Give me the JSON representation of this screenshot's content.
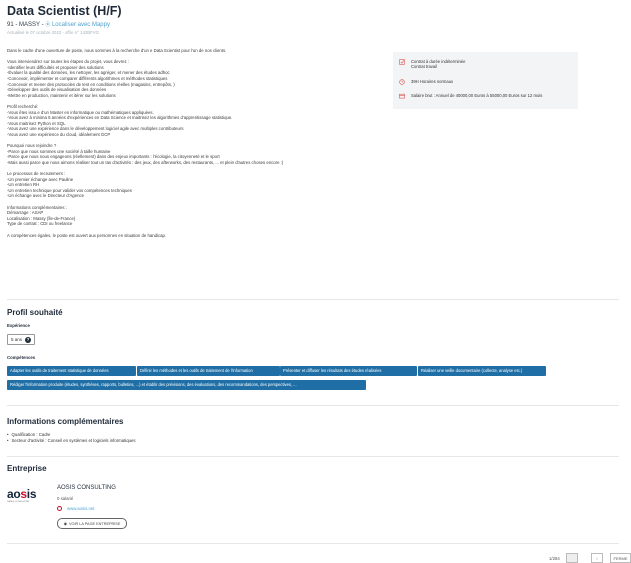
{
  "job": {
    "title": "Data Scientist (H/F)",
    "location": "91 - MASSY -",
    "locate_link": "Localiser avec Mappy",
    "updated": "Actualisé le 07 octobre 2022 - offre n° 142BFVG"
  },
  "description": [
    [
      "Dans le cadre d'une ouverture de poste, nous sommes à la recherche d'un e Data Scientist pour l'un de nos clients."
    ],
    [
      "Vous interviendrez sur toutes les étapes du projet, vous devrez :",
      "-Identifier leurs difficultés et proposer des solutions",
      "-Évaluer la qualité des données, les nettoyer, les agréger, et mener des études adhoc",
      "-Concevoir, implémenter et comparer différents algorithmes et méthodes statistiques",
      "-Concevoir et mener des protocoles de test en conditions réelles (magasins, entrepôts, )",
      "-Développer des outils de visualisation des données",
      "-Mettre en production, maintenir et itérer sur les solutions"
    ],
    [
      "Profil recherché:",
      "-Vous êtes issu.e d'un Master en informatique ou mathématiques appliquées.",
      "-Vous avez à minima 5 années d'expériences en Data Science et maitrisez les algorithmes d'apprentissage statistique.",
      "-Vous maitrisez Python et SQL",
      "-Vous avez une expérience dans le développement logiciel agile avec multiples contributeurs",
      "-Vous avez une expérience du cloud, idéalement GCP"
    ],
    [
      "Pourquoi nous rejoindre ?",
      "-Parce que nous sommes une société à taille humaine",
      "-Parce que nous nous engageons (réellement) dans des enjeux importants : l'écologie, la citoyenneté et le sport",
      "-Mais aussi parce que nous aimons réaliser tout un tas d'activités : des jeux, des afterworks, des restaurants, ... et plein d'autres choses encore :)"
    ],
    [
      "Le processus de recrutement :",
      "-Un premier échange avec Pauline",
      "-Un entretien RH",
      "-Un entretien technique pour valider vos compétences techniques",
      "-Un échange avec le Directeur d'Agence"
    ],
    [
      "Informations complémentaires :",
      "Démarrage : ASAP",
      "Localisation : Massy (Île-de-France)",
      "Type de contrat : CDI ou freelance"
    ],
    [
      "A compétences égales, le poste est ouvert aux personnes en situation de handicap."
    ]
  ],
  "summary": {
    "contract_1": "Contrat à durée indéterminée",
    "contract_2": "Contrat travail",
    "hours": "39H Horaires normaux",
    "salary": "Salaire brut : Annuel de 40000,00 Euros à 55000,00 Euros sur 12 mois"
  },
  "profile": {
    "heading": "Profil souhaité",
    "experience_label": "Expérience",
    "experience_value": "5 ans",
    "experience_help": "?",
    "skills_label": "Compétences",
    "skills": [
      "Adapter les outils de traitement statistique de données",
      "Définir les méthodes et les outils de traitement de l'information",
      "Présenter et diffuser les résultats des études réalisées",
      "Réaliser une veille documentaire (collecte, analyse etc.)",
      "Rédiger l'information produite (études, synthèses, rapports, bulletins, ...) et établir des prévisions, des évaluations, des recommandations, des perspectives, ..."
    ]
  },
  "extra": {
    "heading": "Informations complémentaires",
    "items": [
      "Qualification : Cadre",
      "Secteur d'activité : Conseil en systèmes et logiciels informatiques"
    ]
  },
  "company": {
    "heading": "Entreprise",
    "logo_text": "aosis",
    "logo_tagline": "DATA & CONSULTING",
    "name": "AOSIS CONSULTING",
    "employees": "0 salarié",
    "website": "www.aosis.net",
    "see_page": "VOIR LA PAGE ENTREPRISE"
  },
  "pager": {
    "text": "1/284",
    "next": "›",
    "close": "FERME"
  },
  "colors": {
    "chip": "#1f6fa6",
    "link": "#4fa3d1",
    "accent_red": "#c8102e"
  }
}
